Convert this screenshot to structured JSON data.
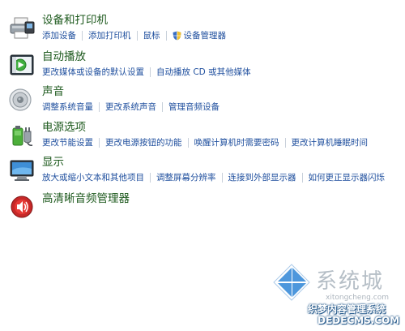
{
  "colors": {
    "title": "#1e5a1e",
    "link": "#1f4f9e",
    "separator": "#c8d0da"
  },
  "categories": [
    {
      "title": "设备和打印机",
      "icon": "printer-icon",
      "links": [
        "添加设备",
        "添加打印机",
        "鼠标",
        "设备管理器"
      ]
    },
    {
      "title": "自动播放",
      "icon": "autoplay-icon",
      "links": [
        "更改媒体或设备的默认设置",
        "自动播放 CD 或其他媒体"
      ]
    },
    {
      "title": "声音",
      "icon": "speaker-icon",
      "links": [
        "调整系统音量",
        "更改系统声音",
        "管理音频设备"
      ]
    },
    {
      "title": "电源选项",
      "icon": "power-battery-icon",
      "links": [
        "更改节能设置",
        "更改电源按钮的功能",
        "唤醒计算机时需要密码",
        "更改计算机睡眠时间"
      ]
    },
    {
      "title": "显示",
      "icon": "monitor-icon",
      "links": [
        "放大或缩小文本和其他项目",
        "调整屏幕分辨率",
        "连接到外部显示器",
        "如何更正显示器闪烁"
      ]
    },
    {
      "title": "高清晰音频管理器",
      "icon": "hd-audio-icon",
      "links": []
    }
  ],
  "watermark": {
    "big": "系统城",
    "small": "xitongcheng.com",
    "cn": "织梦内容管理系统",
    "url": "DEDECMS.COM"
  }
}
